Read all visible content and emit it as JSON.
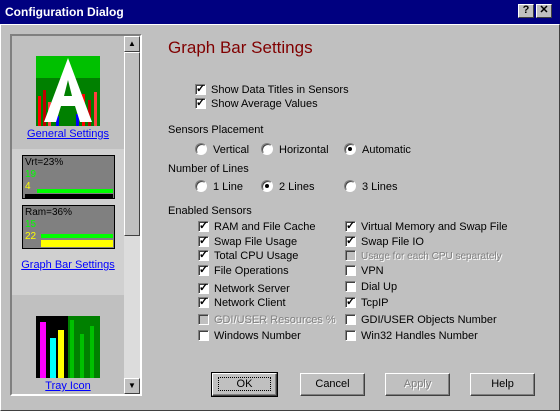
{
  "window": {
    "title": "Configuration Dialog",
    "help_glyph": "?",
    "close_glyph": "✕"
  },
  "sidebar": {
    "items": [
      {
        "label": "General Settings",
        "icon": "letter-a-graph-icon"
      },
      {
        "label": "Graph Bar Settings",
        "icon": "graph-bar-preview-icon",
        "preview": {
          "monitor1": {
            "title": "Vrt=23%",
            "line1": "19",
            "line2": "4"
          },
          "monitor2": {
            "title": "Ram=36%",
            "line1": "15",
            "line2": "22"
          }
        }
      },
      {
        "label": "Tray Icon",
        "icon": "tray-bars-icon"
      }
    ]
  },
  "main": {
    "heading": "Graph Bar Settings",
    "top_options": [
      {
        "label": "Show Data Titles in Sensors",
        "checked": true
      },
      {
        "label": "Show Average Values",
        "checked": true
      }
    ],
    "placement": {
      "label": "Sensors Placement",
      "options": [
        "Vertical",
        "Horizontal",
        "Automatic"
      ],
      "selected": "Automatic"
    },
    "lines": {
      "label": "Number of Lines",
      "options": [
        "1 Line",
        "2 Lines",
        "3 Lines"
      ],
      "selected": "2 Lines"
    },
    "sensors": {
      "label": "Enabled Sensors",
      "left": [
        {
          "label": "RAM and  File Cache",
          "checked": true,
          "enabled": true
        },
        {
          "label": "Swap File Usage",
          "checked": true,
          "enabled": true
        },
        {
          "label": "Total CPU Usage",
          "checked": true,
          "enabled": true
        },
        {
          "label": "File Operations",
          "checked": true,
          "enabled": true
        },
        {
          "label": "Network Server",
          "checked": true,
          "enabled": true
        },
        {
          "label": "Network Client",
          "checked": true,
          "enabled": true
        },
        {
          "label": "GDI/USER Resources %",
          "checked": false,
          "enabled": false
        },
        {
          "label": "Windows Number",
          "checked": false,
          "enabled": true
        }
      ],
      "right": [
        {
          "label": "Virtual Memory and Swap File",
          "checked": true,
          "enabled": true
        },
        {
          "label": "Swap File IO",
          "checked": true,
          "enabled": true
        },
        {
          "label": "Usage for each CPU separately",
          "checked": false,
          "enabled": false
        },
        {
          "label": "VPN",
          "checked": false,
          "enabled": true
        },
        {
          "label": "Dial Up",
          "checked": false,
          "enabled": true
        },
        {
          "label": "TcpIP",
          "checked": true,
          "enabled": true
        },
        {
          "label": "GDI/USER Objects Number",
          "checked": false,
          "enabled": true
        },
        {
          "label": "Win32 Handles Number",
          "checked": false,
          "enabled": true
        }
      ]
    }
  },
  "buttons": {
    "ok": "OK",
    "cancel": "Cancel",
    "apply": "Apply",
    "help": "Help"
  }
}
